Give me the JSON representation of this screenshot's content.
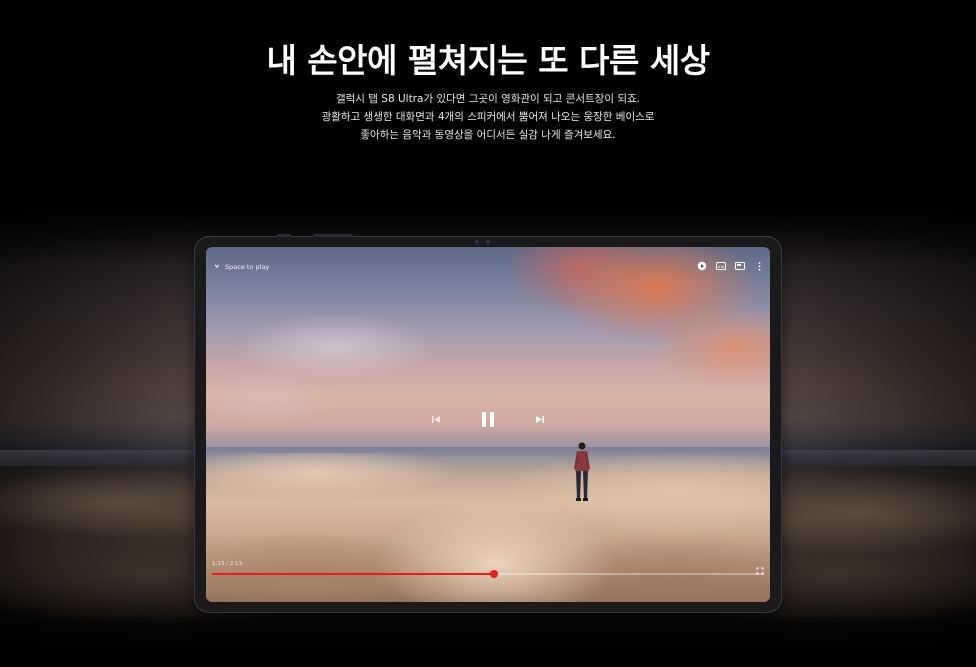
{
  "headline": "내 손안에 펼쳐지는 또 다른 세상",
  "description": {
    "line1": "갤럭시 탭 S8 Ultra가 있다면 그곳이 영화관이 되고 콘서트장이 되죠.",
    "line2": "광활하고 생생한 대화면과 4개의 스피커에서 뿜어져 나오는 웅장한 베이스로",
    "line3": "좋아하는 음악과 동영상을 어디서든 실감 나게 즐겨보세요."
  },
  "player": {
    "title": "Space to play",
    "time": "1:13 / 2:13",
    "progress_fraction": 0.51,
    "accent_color": "#e51e1e",
    "icons": {
      "back": "chevron-down-icon",
      "autoplay": "autoplay-toggle-icon",
      "subtitles": "captions-icon",
      "cast": "cast-icon",
      "more": "more-vertical-icon",
      "previous": "skip-previous-icon",
      "pause": "pause-icon",
      "next": "skip-next-icon",
      "fullscreen": "fullscreen-icon"
    }
  }
}
